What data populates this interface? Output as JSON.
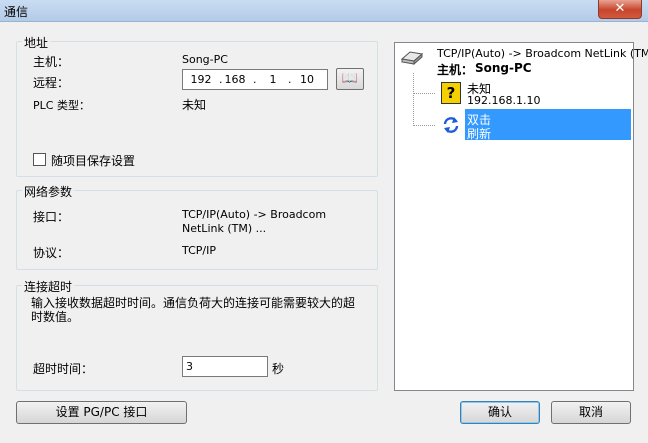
{
  "window": {
    "title": "通信",
    "close": "✕"
  },
  "address": {
    "title": "地址",
    "host_label": "主机：",
    "host_value": "Song-PC",
    "remote_label": "远程：",
    "ip": [
      "192",
      "168",
      "1",
      "10"
    ],
    "plc_type_label": "PLC 类型：",
    "plc_type_value": "未知",
    "save_checkbox_label": "随项目保存设置",
    "save_checked": false
  },
  "network": {
    "title": "网络参数",
    "interface_label": "接口：",
    "interface_value": "TCP/IP(Auto) -> Broadcom NetLink (TM) ...",
    "protocol_label": "协议：",
    "protocol_value": "TCP/IP"
  },
  "timeout": {
    "title": "连接超时",
    "description": "输入接收数据超时时间。通信负荷大的连接可能需要较大的超时数值。",
    "label": "超时时间：",
    "value": "3",
    "unit": "秒"
  },
  "tree": {
    "root_line1": "TCP/IP(Auto) -> Broadcom NetLink (TM)",
    "host_prefix": "主机：",
    "host_name": "Song-PC",
    "device_name": "未知",
    "device_ip": "192.168.1.10",
    "refresh_line1": "双击",
    "refresh_line2": "刷新"
  },
  "buttons": {
    "pgpc": "设置 PG/PC 接口",
    "ok": "确认",
    "cancel": "取消"
  },
  "colors": {
    "selection": "#3399ff",
    "help_icon": "#f5d000",
    "refresh_icon": "#1e5bd8"
  }
}
